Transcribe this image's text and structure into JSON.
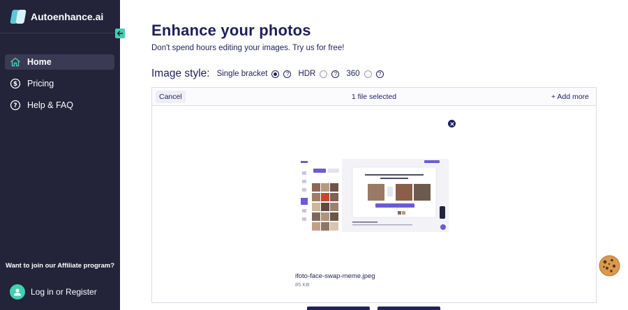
{
  "sidebar": {
    "brand": "Autoenhance.ai",
    "items": [
      {
        "label": "Home",
        "icon": "home-icon",
        "active": true
      },
      {
        "label": "Pricing",
        "icon": "dollar-icon",
        "active": false
      },
      {
        "label": "Help & FAQ",
        "icon": "help-icon",
        "active": false
      }
    ],
    "affiliate_text": "Want to join our Affiliate program?",
    "login_label": "Log in or Register"
  },
  "main": {
    "title": "Enhance your photos",
    "subtitle": "Don't spend hours editing your images. Try us for free!",
    "image_style": {
      "label": "Image style:",
      "options": [
        {
          "label": "Single bracket",
          "checked": true
        },
        {
          "label": "HDR",
          "checked": false
        },
        {
          "label": "360",
          "checked": false
        }
      ]
    },
    "upload": {
      "cancel_label": "Cancel",
      "selected_text": "1 file selected",
      "add_more_label": "+ Add more",
      "file": {
        "name": "ifoto-face-swap-meme.jpeg",
        "size": "85 KB"
      }
    }
  },
  "colors": {
    "sidebar_bg": "#23233a",
    "accent": "#3fd1b0",
    "text_primary": "#1f1f5c"
  }
}
